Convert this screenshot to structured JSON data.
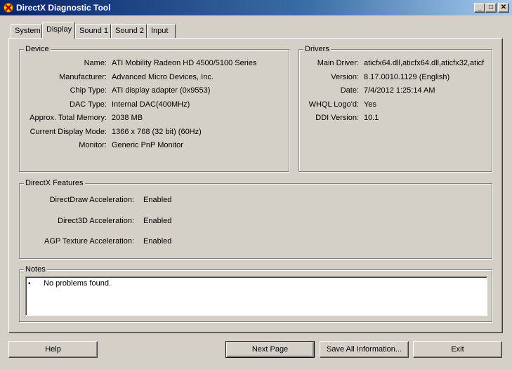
{
  "window": {
    "title": "DirectX Diagnostic Tool",
    "minimize_glyph": "_",
    "maximize_glyph": "□",
    "close_glyph": "✕"
  },
  "tabs": [
    {
      "label": "System",
      "active": false
    },
    {
      "label": "Display",
      "active": true
    },
    {
      "label": "Sound 1",
      "active": false
    },
    {
      "label": "Sound 2",
      "active": false
    },
    {
      "label": "Input",
      "active": false
    }
  ],
  "device": {
    "legend": "Device",
    "rows": [
      {
        "label": "Name:",
        "value": "ATI Mobility Radeon HD 4500/5100 Series"
      },
      {
        "label": "Manufacturer:",
        "value": "Advanced Micro Devices, Inc."
      },
      {
        "label": "Chip Type:",
        "value": "ATI display adapter (0x9553)"
      },
      {
        "label": "DAC Type:",
        "value": "Internal DAC(400MHz)"
      },
      {
        "label": "Approx. Total Memory:",
        "value": "2038 MB"
      },
      {
        "label": "Current Display Mode:",
        "value": "1366 x 768 (32 bit) (60Hz)"
      },
      {
        "label": "Monitor:",
        "value": "Generic PnP Monitor"
      }
    ]
  },
  "drivers": {
    "legend": "Drivers",
    "rows": [
      {
        "label": "Main Driver:",
        "value": "aticfx64.dll,aticfx64.dll,aticfx32,aticf"
      },
      {
        "label": "Version:",
        "value": "8.17.0010.1129 (English)"
      },
      {
        "label": "Date:",
        "value": "7/4/2012 1:25:14 AM"
      },
      {
        "label": "WHQL Logo'd:",
        "value": "Yes"
      },
      {
        "label": "DDI Version:",
        "value": "10.1"
      }
    ]
  },
  "features": {
    "legend": "DirectX Features",
    "rows": [
      {
        "label": "DirectDraw Acceleration:",
        "value": "Enabled"
      },
      {
        "label": "Direct3D Acceleration:",
        "value": "Enabled"
      },
      {
        "label": "AGP Texture Acceleration:",
        "value": "Enabled"
      }
    ]
  },
  "notes": {
    "legend": "Notes",
    "bullet": "•",
    "items": [
      "No problems found."
    ]
  },
  "buttons": {
    "help": "Help",
    "next_page": "Next Page",
    "save_all": "Save All Information...",
    "exit": "Exit"
  }
}
